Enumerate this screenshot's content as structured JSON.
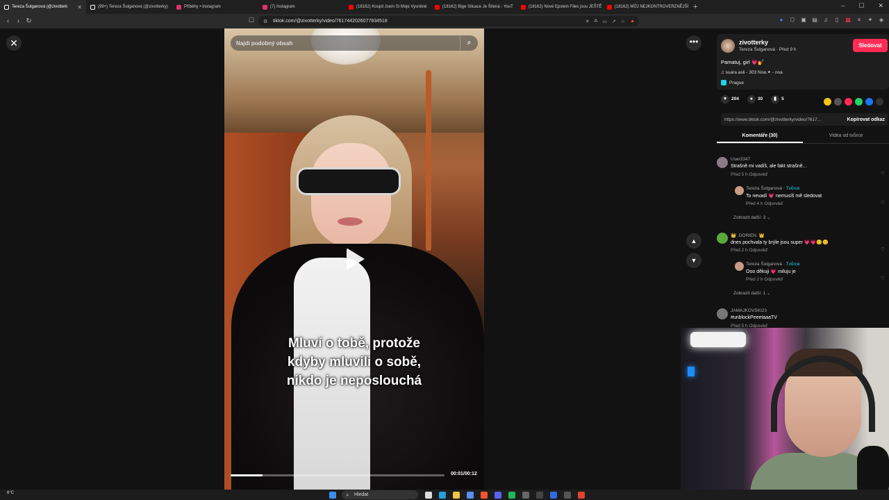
{
  "browser": {
    "tabs": [
      {
        "label": "Tereza Šulganová (@zivotterk",
        "active": true,
        "color": "#ffffff"
      },
      {
        "label": "(99+) Tereza Šulganová (@zivotterky)",
        "active": false,
        "color": "#ffffff"
      },
      {
        "label": "Příběhy • Instagram",
        "active": false,
        "color": "#e1306c"
      },
      {
        "label": "(7) Instagram",
        "active": false,
        "color": "#e1306c"
      },
      {
        "label": "(18162) Koupil Jsem Si Moje Vysněné",
        "active": false,
        "color": "#ff0000"
      },
      {
        "label": "(18162) Bige Situace Je Šílená - YouT",
        "active": false,
        "color": "#ff0000"
      },
      {
        "label": "(18162) Nové Epstein Files jsou JEŠTĚ",
        "active": false,
        "color": "#ff0000"
      },
      {
        "label": "(18162) MŮJ NEJKONTROVERZNĚJŠÍ",
        "active": false,
        "color": "#ff0000"
      }
    ],
    "new_tab": "+",
    "window_controls": [
      "–",
      "☐",
      "✕"
    ],
    "url": "tiktok.com/@zivotterky/video/7617442026077834518"
  },
  "video": {
    "search_placeholder": "Najdi podobný obsah",
    "caption": "Mluví o tobě, protože\nkdyby mluvili o sobě,\nnikdo je neposlouchá",
    "time": "00:01/00:12",
    "progress_fraction": 0.15
  },
  "author": {
    "username": "zivotterky",
    "subtitle": "Tereza Šulganová · Před 9 h",
    "follow_label": "Sledovat",
    "description": "Pamatuj, girl 💗💅",
    "music": "♫  suara asli - 303 Noa.✦ - noa",
    "location": "Prague"
  },
  "stats": {
    "likes": "204",
    "comments": "30",
    "saves": "5"
  },
  "share": {
    "link": "https://www.tiktok.com/@zivotterky/video/7617...",
    "copy_label": "Kopírovat odkaz",
    "colors": [
      "#f5c518",
      "#555555",
      "#fe2c55",
      "#25d366",
      "#1877f2"
    ]
  },
  "panel_tabs": [
    "Komentáře (30)",
    "Videa od tvůrce"
  ],
  "comments": [
    {
      "name": "User2347",
      "text": "Strašně mi vadíš, ale fakt strašně...",
      "meta": "Před 5 h   Odpověď",
      "reply": false,
      "avatar": "#8a7a86"
    },
    {
      "name": "Tereza Šulganová · ",
      "creator": "Tvůrce",
      "text": "To nevadí 💗 nemusíš mě sledovat",
      "meta": "Před 4 h   Odpověď",
      "reply": true,
      "avatar": "#c99a86"
    },
    {
      "name": "👑 .DORIEN. 👑",
      "text": "dnes pochvala ty brýle jsou super 💗💗😊😊",
      "meta": "Před 2 h   Odpověď",
      "reply": false,
      "avatar": "#5aa83c"
    },
    {
      "name": "Tereza Šulganová · ",
      "creator": "Tvůrce",
      "text": "Ooo děkuji 💗 miluju je",
      "meta": "Před 2 h   Odpověď",
      "reply": true,
      "avatar": "#c99a86"
    },
    {
      "name": "JAMAJKOVSKI23",
      "text": "#unblockPeeetaaaTV",
      "meta": "Před 5 h   Odpověď",
      "reply": false,
      "avatar": "#777777"
    }
  ],
  "show_more": [
    "Zobrazit další: 3  ⌄",
    "Zobrazit další: 1  ⌄"
  ],
  "taskbar": {
    "weather": "6°C",
    "search_label": "Hledat"
  },
  "icons": {
    "close": "✕",
    "more": "•••",
    "up": "⌃",
    "down": "⌄",
    "search": "⌕",
    "heart": "♥",
    "comment": "💬",
    "bookmark": "🔖"
  }
}
